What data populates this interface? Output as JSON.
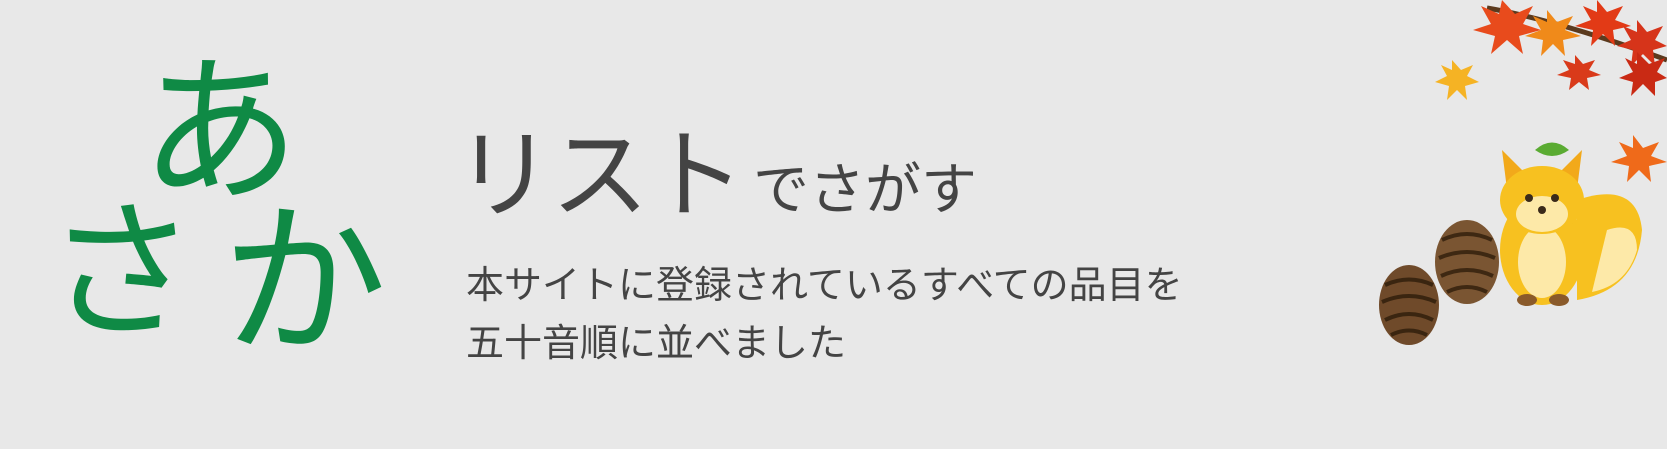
{
  "kana": {
    "a": "あ",
    "sa": "さ",
    "ka": "か"
  },
  "heading": {
    "main": "リスト",
    "sub": "でさがす"
  },
  "description": {
    "line1": "本サイトに登録されているすべての品目を",
    "line2": "五十音順に並べました"
  },
  "colors": {
    "background": "#e8e8e8",
    "kana": "#0f8a45",
    "text": "#444444"
  },
  "illustration": {
    "icons": [
      "maple-leaf-icon",
      "fox-icon",
      "pine-cone-icon"
    ]
  }
}
